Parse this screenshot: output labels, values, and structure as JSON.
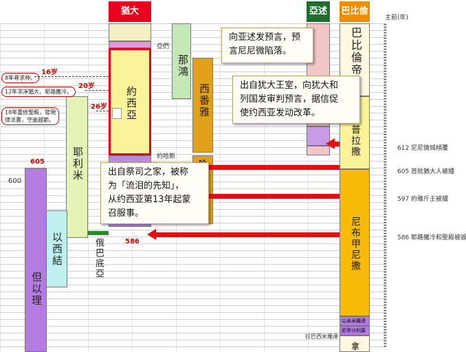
{
  "headers": {
    "judah": "猶大",
    "assyria": "亞述",
    "babylon": "巴比倫",
    "year_axis": "主前(年)"
  },
  "kings": {
    "josiah": "約西亞",
    "jehoiakim": "約哈斯",
    "nahum": "那鴻",
    "zephaniah": "西番雅",
    "jeremiah": "耶利米",
    "ezekiel": "以西結",
    "daniel": "但以理",
    "obadiah": "俄巴底亞",
    "habakkuk_top": "哈",
    "amon": "亞們",
    "babylon_top": "巴比倫帝",
    "nabopolassar": "普拉撒",
    "nebuchadnezzar": "尼布甲尼撒",
    "evil_merodach": "以未米羅達",
    "neriglissar": "尼甲沙利薛",
    "labashi": "拉巴西米羅達",
    "bottom_char": "拿"
  },
  "year_labels": {
    "y605": "605",
    "y600": "600",
    "y586": "586"
  },
  "age_marks": {
    "a16": "16岁",
    "a20": "20岁",
    "a26": "26岁"
  },
  "notes": {
    "n8": "8年尋求神。",
    "n12": "12年潔淨猶大、耶路撒冷。",
    "n18a": "18年重修聖殿，發現",
    "n18b": "律法書，守逾越節。"
  },
  "events": {
    "e612": "612 尼尼微城傾覆",
    "e605": "605 首批猶大人被擄",
    "e597": "597 約雅斤王被擄",
    "e586": "586 耶路撒冷和聖殿被毀"
  },
  "callouts": {
    "nahum_line1": "向亚述发预言，预",
    "nahum_line2": "言尼尼微陷落。",
    "zeph_line1": "出自犹大王室，向犹大和",
    "zeph_line2": "列国发审判预言，据信促",
    "zeph_line3": "使约西亚发动改革。",
    "jer_line1": "出自祭司之家，被称",
    "jer_line2": "为「流泪的先知」，",
    "jer_line3": "从约西亚第13年起蒙",
    "jer_line4": "召服事。"
  },
  "colors": {
    "judah_header": "#e8001c",
    "assyria_header": "#1f6e2e",
    "babylon_header": "#f08c00",
    "arrow": "#e01010"
  }
}
